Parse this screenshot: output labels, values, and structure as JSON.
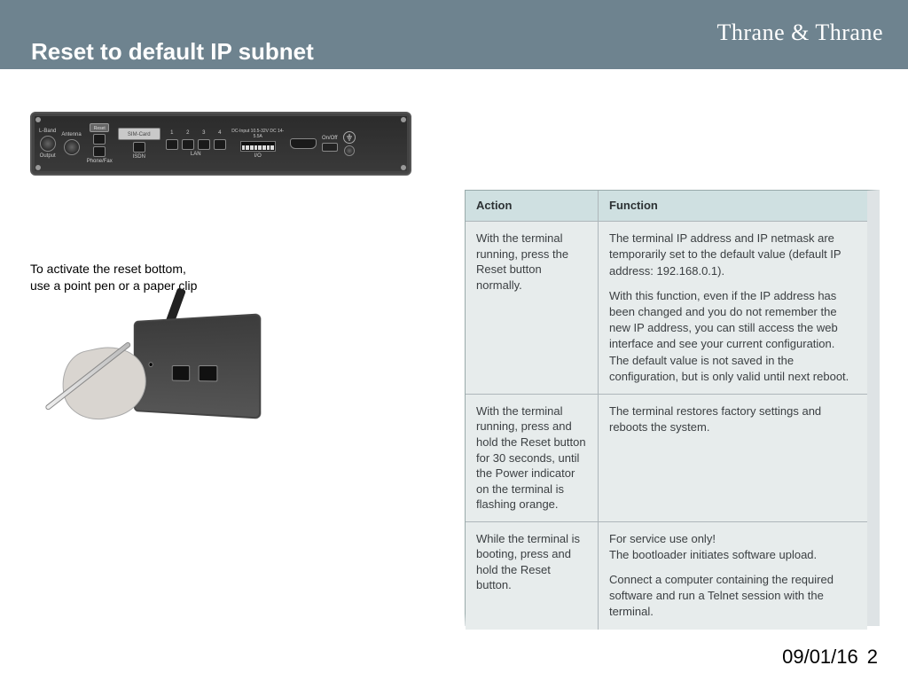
{
  "brand": "Thrane & Thrane",
  "title": "Reset to default IP subnet",
  "reset_instruction": "To activate the reset bottom,\nuse a point pen or a paper clip",
  "footer_date": "09/01/16",
  "footer_page": "2",
  "device_labels": {
    "lband": "L-Band",
    "output": "Output",
    "antenna": "Antenna",
    "reset": "Reset",
    "sim": "SIM-Card",
    "phonefax": "Phone/Fax",
    "isdn": "ISDN",
    "lan": "LAN",
    "lan1": "1",
    "lan2": "2",
    "lan3": "3",
    "lan4": "4",
    "dcinput": "DC-Input 10.5-32V DC 14-5.5A",
    "io": "I/O",
    "onoff": "On/Off"
  },
  "table": {
    "head_action": "Action",
    "head_function": "Function",
    "rows": [
      {
        "action": "With the terminal running, press the Reset button normally.",
        "func1": "The terminal IP address and IP netmask are temporarily set to the default value (default IP address: 192.168.0.1).",
        "func2": "With this function, even if the IP address has been changed and you do not remember the new IP address, you can still access the web interface and see your current configuration. The default value is not saved in the configuration, but is only valid until next reboot."
      },
      {
        "action": "With the terminal running, press and hold the Reset button for 30 seconds, until the Power indicator on the terminal is flashing orange.",
        "func1": "The terminal restores factory settings and reboots the system."
      },
      {
        "action": "While the terminal is booting, press and hold the Reset button.",
        "func1": "For service use only!\nThe bootloader initiates software upload.",
        "func2": "Connect a computer containing the required software and run a Telnet session with the terminal."
      }
    ]
  }
}
